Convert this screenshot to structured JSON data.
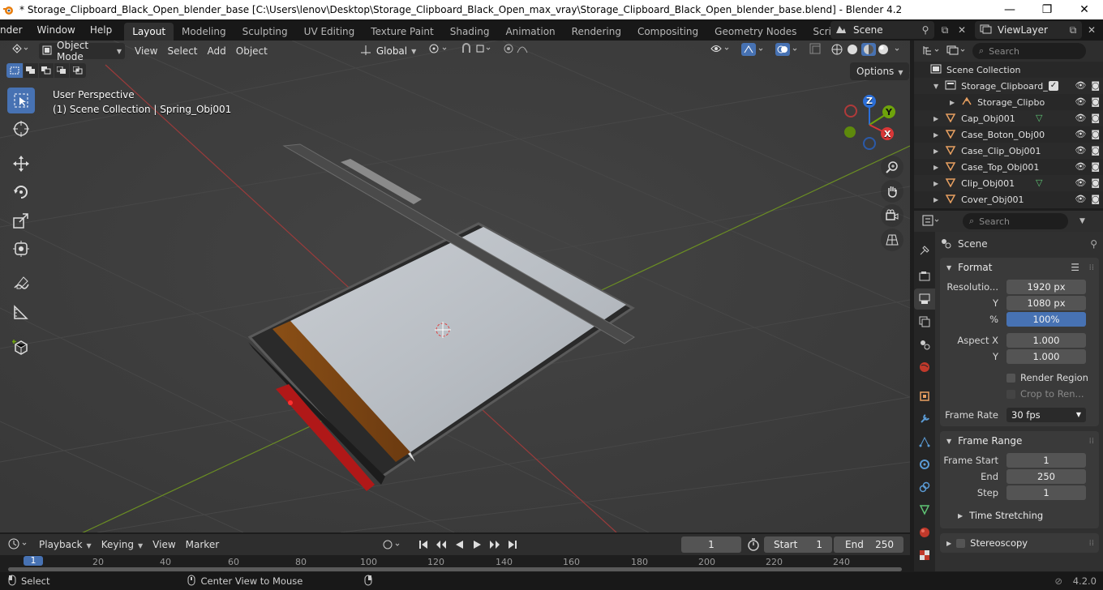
{
  "window": {
    "title": "* Storage_Clipboard_Black_Open_blender_base [C:\\Users\\lenov\\Desktop\\Storage_Clipboard_Black_Open_max_vray\\Storage_Clipboard_Black_Open_blender_base.blend] - Blender 4.2",
    "minimize": "—",
    "maximize": "❐",
    "close": "✕"
  },
  "topbar": {
    "menus": [
      "nder",
      "Window",
      "Help"
    ],
    "workspaces": [
      "Layout",
      "Modeling",
      "Sculpting",
      "UV Editing",
      "Texture Paint",
      "Shading",
      "Animation",
      "Rendering",
      "Compositing",
      "Geometry Nodes",
      "Scripting"
    ],
    "add_tab": "+",
    "scene": "Scene",
    "view_layer": "ViewLayer"
  },
  "viewport": {
    "mode": "Object Mode",
    "menus": [
      "View",
      "Select",
      "Add",
      "Object"
    ],
    "orientation": "Global",
    "options_label": "Options",
    "perspective": "User Perspective",
    "collection_info": "(1) Scene Collection | Spring_Obj001",
    "gizmo": {
      "x": "X",
      "y": "Y",
      "z": "Z"
    }
  },
  "outliner": {
    "search_placeholder": "Search",
    "rows": [
      {
        "label": "Scene Collection"
      },
      {
        "label": "Storage_Clipboard_"
      },
      {
        "label": "Storage_Clipbo"
      },
      {
        "label": "Cap_Obj001"
      },
      {
        "label": "Case_Boton_Obj00"
      },
      {
        "label": "Case_Clip_Obj001"
      },
      {
        "label": "Case_Top_Obj001"
      },
      {
        "label": "Clip_Obj001"
      },
      {
        "label": "Cover_Obj001"
      }
    ]
  },
  "properties": {
    "search_placeholder": "Search",
    "context": "Scene",
    "format": {
      "title": "Format",
      "resolution_label": "Resolutio...",
      "resolution_x": "1920 px",
      "y_label": "Y",
      "resolution_y": "1080 px",
      "percent_label": "%",
      "percent": "100%",
      "aspect_label": "Aspect X",
      "aspect_x": "1.000",
      "aspect_y": "1.000",
      "render_region": "Render Region",
      "crop": "Crop to Ren...",
      "frame_rate_label": "Frame Rate",
      "frame_rate": "30 fps"
    },
    "frame_range": {
      "title": "Frame Range",
      "start_label": "Frame Start",
      "start": "1",
      "end_label": "End",
      "end": "250",
      "step_label": "Step",
      "step": "1"
    },
    "time_stretching": "Time Stretching",
    "stereoscopy": "Stereoscopy"
  },
  "timeline": {
    "menus": [
      "Playback",
      "Keying",
      "View",
      "Marker"
    ],
    "current_frame": "1",
    "start_label": "Start",
    "start": "1",
    "end_label": "End",
    "end": "250",
    "ticks": [
      "1",
      "20",
      "40",
      "60",
      "80",
      "100",
      "120",
      "140",
      "160",
      "180",
      "200",
      "220",
      "240"
    ]
  },
  "statusbar": {
    "select": "Select",
    "center_view": "Center View to Mouse",
    "version": "4.2.0"
  }
}
